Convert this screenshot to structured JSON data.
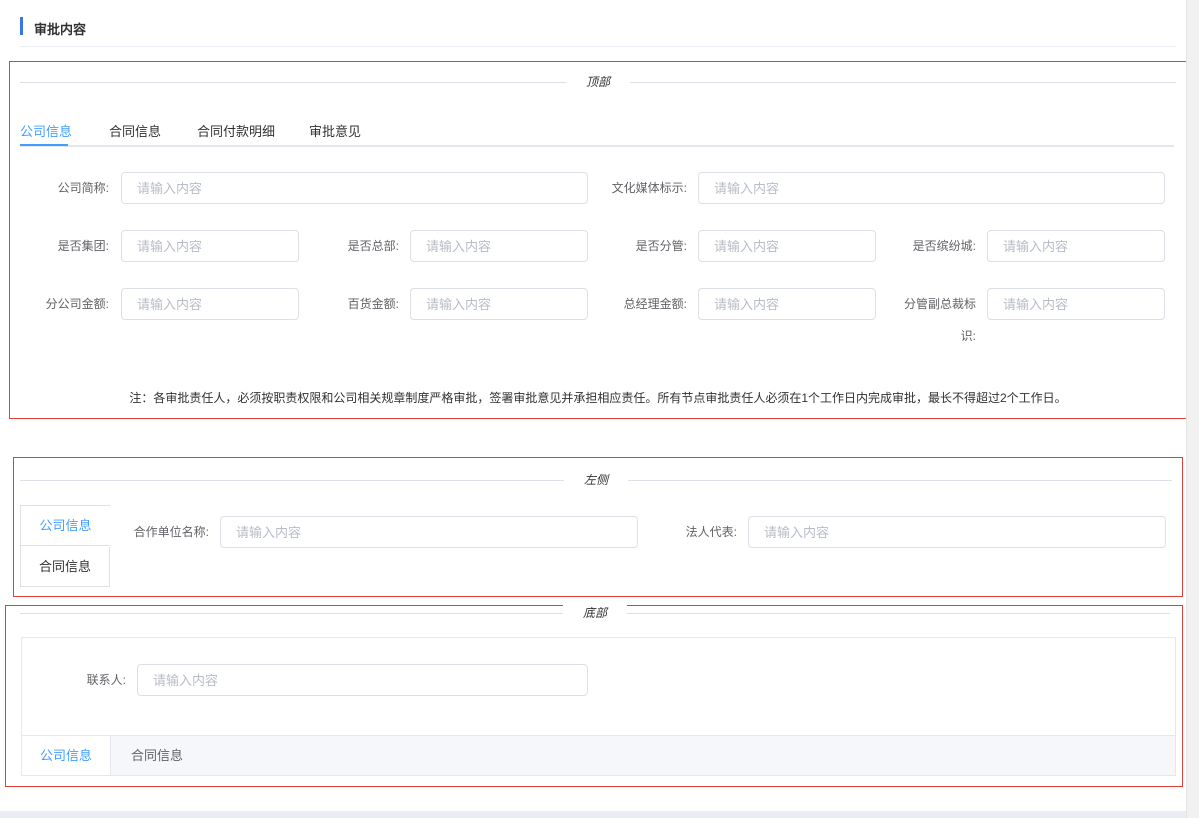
{
  "header": {
    "title": "审批内容"
  },
  "top": {
    "divider_label": "顶部",
    "tabs": [
      "公司信息",
      "合同信息",
      "合同付款明细",
      "审批意见"
    ],
    "fields": [
      {
        "label": "公司简称:",
        "placeholder": "请输入内容"
      },
      {
        "label": "文化媒体标示:",
        "placeholder": "请输入内容"
      },
      {
        "label": "是否集团:",
        "placeholder": "请输入内容"
      },
      {
        "label": "是否总部:",
        "placeholder": "请输入内容"
      },
      {
        "label": "是否分管:",
        "placeholder": "请输入内容"
      },
      {
        "label": "是否缤纷城:",
        "placeholder": "请输入内容"
      },
      {
        "label": "分公司金额:",
        "placeholder": "请输入内容"
      },
      {
        "label": "百货金额:",
        "placeholder": "请输入内容"
      },
      {
        "label": "总经理金额:",
        "placeholder": "请输入内容"
      },
      {
        "label_line1": "分管副总裁标",
        "label_line2": "识:",
        "placeholder": "请输入内容"
      }
    ],
    "note": "注：各审批责任人，必须按职责权限和公司相关规章制度严格审批，签署审批意见并承担相应责任。所有节点审批责任人必须在1个工作日内完成审批，最长不得超过2个工作日。"
  },
  "left": {
    "divider_label": "左侧",
    "tabs": [
      "公司信息",
      "合同信息"
    ],
    "fields": [
      {
        "label": "合作单位名称:",
        "placeholder": "请输入内容"
      },
      {
        "label": "法人代表:",
        "placeholder": "请输入内容"
      }
    ]
  },
  "bottom": {
    "divider_label": "底部",
    "tabs": [
      "公司信息",
      "合同信息"
    ],
    "fields": [
      {
        "label": "联系人:",
        "placeholder": "请输入内容"
      }
    ]
  },
  "colors": {
    "accent": "#409eff",
    "frame": "#e0403c",
    "title_bar": "#3b74e5"
  }
}
